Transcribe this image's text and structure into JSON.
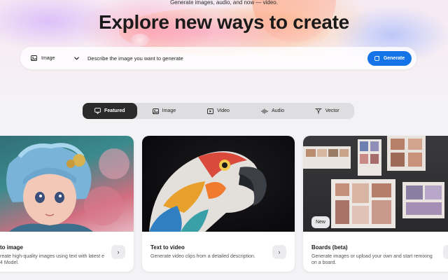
{
  "hero": {
    "subtitle": "Generate images, audio, and now — video.",
    "headline": "Explore new ways to create"
  },
  "prompt": {
    "type_label": "Image",
    "type_icon": "image-icon",
    "placeholder": "Describe the image you want to generate",
    "generate_label": "Generate",
    "generate_icon": "sparkle-icon",
    "accent": "#1473e6"
  },
  "tabs": [
    {
      "label": "Featured",
      "icon": "featured-icon",
      "active": true
    },
    {
      "label": "Image",
      "icon": "image-icon",
      "active": false
    },
    {
      "label": "Video",
      "icon": "video-icon",
      "active": false
    },
    {
      "label": "Audio",
      "icon": "audio-icon",
      "active": false
    },
    {
      "label": "Vector",
      "icon": "vector-icon",
      "active": false
    }
  ],
  "cards": [
    {
      "title": "to image",
      "description": "reate high-quality images using text with latest e 4 Model.",
      "arrow": "›"
    },
    {
      "title": "Text to video",
      "description": "Generate video clips from a detailed description.",
      "arrow": "›"
    },
    {
      "title": "Boards (beta)",
      "description": "Generate images or upload your own and start remixing on a board.",
      "badge": "New",
      "arrow": "›"
    }
  ]
}
